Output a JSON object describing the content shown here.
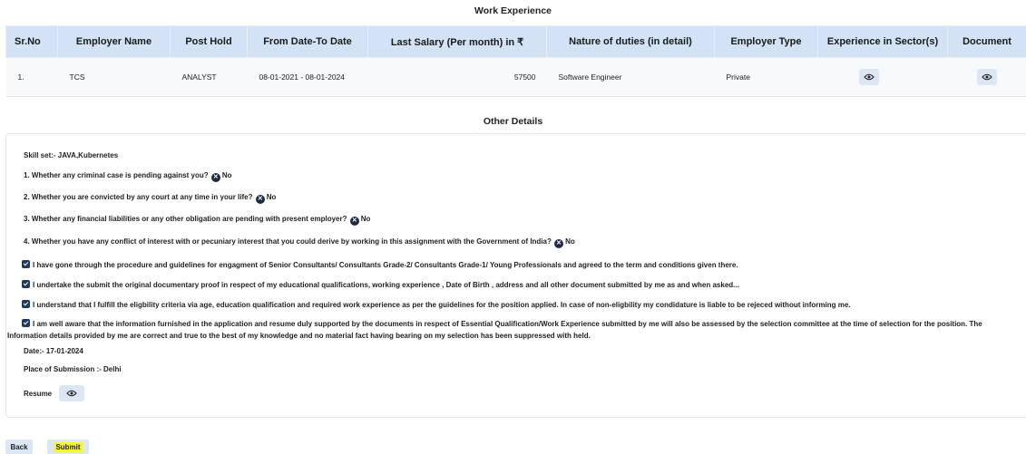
{
  "work_experience": {
    "title": "Work Experience",
    "headers": [
      "Sr.No",
      "Employer Name",
      "Post Hold",
      "From Date-To Date",
      "Last Salary (Per month) in ₹",
      "Nature of duties (in detail)",
      "Employer Type",
      "Experience in Sector(s)",
      "Document"
    ],
    "rows": [
      {
        "sr": "1.",
        "employer": "TCS",
        "post": "ANALYST",
        "dates": "08-01-2021 - 08-01-2024",
        "salary": "57500",
        "duties": "Software Engineer",
        "type": "Private",
        "sector_icon": "eye-icon",
        "document_icon": "eye-icon"
      }
    ]
  },
  "other_details": {
    "title": "Other Details",
    "skill_set": "Skill set:- JAVA,Kubernetes",
    "questions": [
      {
        "text": "1. Whether any criminal case is pending against you?",
        "answer": "No"
      },
      {
        "text": "2. Whether you are convicted by any court at any time in your life?",
        "answer": "No"
      },
      {
        "text": "3. Whether any financial liabilities or any other obligation are pending with present employer?",
        "answer": "No"
      },
      {
        "text": "4. Whether you have any conflict of interest with or pecuniary interest that you could derive by working in this assignment with the Government of India?",
        "answer": "No"
      }
    ],
    "declarations": [
      "I have gone through the procedure and guidelines for engagment of Senior Consultants/ Consultants Grade-2/ Consultants Grade-1/ Young Professionals and agreed to the term and conditions given there.",
      "I undertake the submit the original documentary proof in respect of my educational qualifications, working experience , Date of Birth , address and all other document submitted by me as and when asked...",
      "I understand that I fulfill the eligbility criteria via age, education qualification and required work experience as per the guidelines for the position applied. In case of non-eligbility my condidature is liable to be rejeced without informing me.",
      "I am well aware that the information furnished in the application and resume duly supported by the documents in respect of Essential Qualification/Work Experience submitted by me will also be assessed by the selection committee at the time of selection for the position. The Information details provided by me are correct and true to the best of my knowledge and no material fact having bearing on my selection has been suppressed with held."
    ],
    "date": "Date:- 17-01-2024",
    "place": "Place of Submission :- Delhi",
    "resume_label": "Resume"
  },
  "actions": {
    "back_label": "Back",
    "submit_label": "Submit"
  },
  "colors": {
    "header_bg": "#d3e3f5",
    "button_bg": "#dbe7f5",
    "checkbox": "#1f3a5c",
    "highlight": "#f4f43a"
  }
}
